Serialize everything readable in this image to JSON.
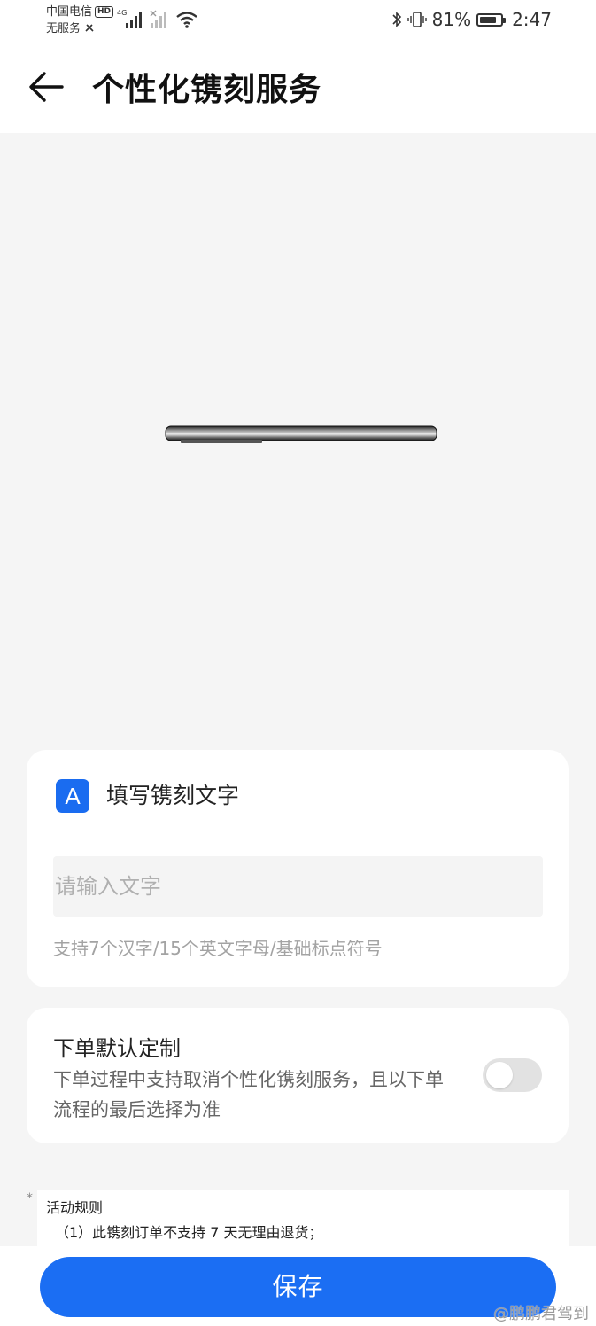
{
  "status_bar": {
    "carrier_line1": "中国电信",
    "hd_badge": "HD",
    "carrier_line2": "无服务",
    "network_type": "4G",
    "battery_percent": "81%",
    "battery_level": 0.81,
    "time": "2:47"
  },
  "header": {
    "title": "个性化镌刻服务"
  },
  "engrave_card": {
    "badge": "A",
    "title": "填写镌刻文字",
    "input_placeholder": "请输入文字",
    "input_value": "",
    "hint": "支持7个汉字/15个英文字母/基础标点符号"
  },
  "default_card": {
    "title": "下单默认定制",
    "description": "下单过程中支持取消个性化镌刻服务，且以下单流程的最后选择为准",
    "toggle_on": false
  },
  "rules": {
    "marker": "*",
    "title": "活动规则",
    "line1": "（1）此镌刻订单不支持 7 天无理由退货；"
  },
  "save_button": "保存",
  "watermark": "@鹏鹏君驾到",
  "colors": {
    "accent": "#1b6ef3",
    "background": "#f5f5f5",
    "card": "#ffffff"
  }
}
